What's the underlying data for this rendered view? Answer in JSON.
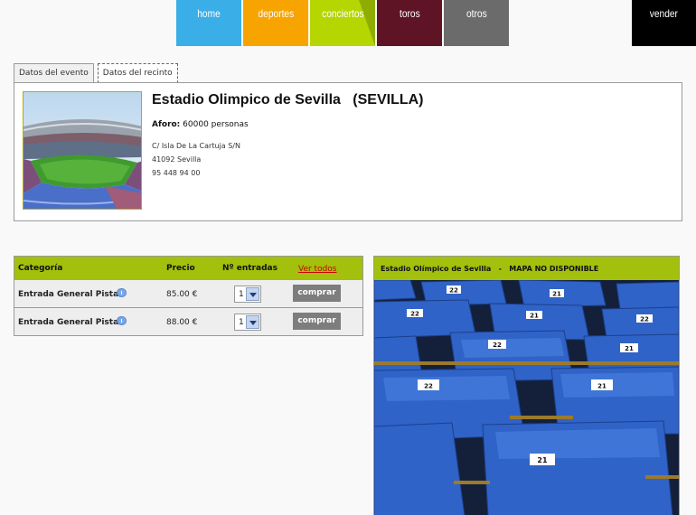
{
  "nav": {
    "items": [
      "home",
      "deportes",
      "conciertos",
      "toros",
      "otros"
    ],
    "sell": "vender",
    "colors": {
      "home": "#3aaee6",
      "deportes": "#f7a400",
      "conciertos": "#b5d600",
      "toros": "#5f1426",
      "otros": "#6b6b6b",
      "vender": "#000000"
    }
  },
  "tabs": [
    "Datos del evento",
    "Datos del recinto"
  ],
  "venue": {
    "name": "Estadio Olimpico de Sevilla   (SEVILLA)",
    "aforo_label": "Aforo:",
    "aforo_value": "60000 personas",
    "address": [
      "C/ Isla De La Cartuja S/N",
      "41092 Sevilla",
      "95 448 94 00"
    ]
  },
  "tickets": {
    "headers": {
      "category": "Categoría",
      "price": "Precio",
      "count": "Nº entradas",
      "see_all": "Ver todos"
    },
    "rows": [
      {
        "category": "Entrada General Pista",
        "price": "85.00 €",
        "qty": "1",
        "buy": "comprar"
      },
      {
        "category": "Entrada General Pista",
        "price": "88.00 €",
        "qty": "1",
        "buy": "comprar"
      }
    ]
  },
  "map": {
    "title": "Estadio Olímpico de Sevilla   -   MAPA NO DISPONIBLE",
    "seat_numbers": [
      "22",
      "21",
      "22",
      "21",
      "22",
      "22",
      "21",
      "22",
      "21"
    ]
  },
  "colors": {
    "accent_green": "#a3c00c",
    "link_red": "#cc0000"
  }
}
